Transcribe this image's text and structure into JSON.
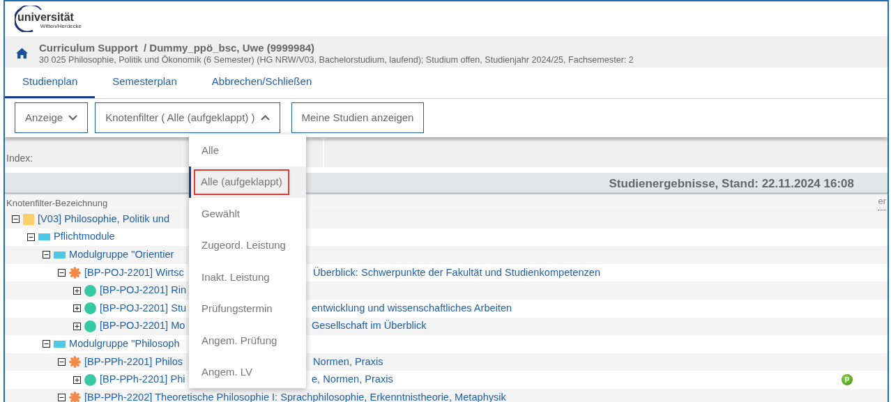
{
  "logo": {
    "wordmark_left": "uni",
    "wordmark_right": "versität",
    "subtitle": "Witten/Herdecke"
  },
  "header": {
    "title": "Curriculum Support  / Dummy_ppö_bsc, Uwe (9999984)",
    "subtitle": "30 025 Philosophie, Politik und Ökonomik (6 Semester) (HG NRW/V03, Bachelorstudium, laufend); Studium offen, Studienjahr 2024/25, Fachsemester: 2"
  },
  "tabs": [
    {
      "label": "Studienplan",
      "selected": true
    },
    {
      "label": "Semesterplan",
      "selected": false
    },
    {
      "label": "Abbrechen/Schließen",
      "selected": false
    }
  ],
  "toolbar": [
    {
      "label": "Anzeige",
      "kind": "dropdown",
      "expanded": false
    },
    {
      "label": "Knotenfilter ( Alle (aufgeklappt) )",
      "kind": "dropdown",
      "expanded": true
    },
    {
      "label": "Meine Studien anzeigen",
      "kind": "button"
    }
  ],
  "dropdown": [
    {
      "label": "Alle",
      "selected": false
    },
    {
      "label": "Alle (aufgeklappt)",
      "selected": true
    },
    {
      "label": "Gewählt",
      "selected": false
    },
    {
      "label": "Zugeord. Leistung",
      "selected": false
    },
    {
      "label": "Inakt. Leistung",
      "selected": false
    },
    {
      "label": "Prüfungstermin",
      "selected": false
    },
    {
      "label": "Angem. Prüfung",
      "selected": false
    },
    {
      "label": "Angem. LV",
      "selected": false
    }
  ],
  "index_label": "Index:",
  "results_title": "Studienergebnisse, Stand: 22.11.2024 16:08",
  "table": {
    "column_1": "Knotenfilter-Bezeichnung",
    "column_2": "er",
    "tree": [
      {
        "kind": "program",
        "text": "[V03] Philosophie, Politik und",
        "expanded": true,
        "children": [
          {
            "kind": "group",
            "text": "Pflichtmodule",
            "expanded": true,
            "children": [
              {
                "kind": "group",
                "text": "Modulgruppe \"Orientier",
                "expanded": true,
                "children": [
                  {
                    "kind": "module",
                    "text": "[BP-POJ-2201] Wirtsc",
                    "text_right": "Überblick: Schwerpunkte der Fakultät und Studienkompetenzen",
                    "expanded": true,
                    "children": [
                      {
                        "kind": "course",
                        "text": "[BP-POJ-2201] Rin",
                        "expanded": false
                      },
                      {
                        "kind": "course",
                        "text": "[BP-POJ-2201] Stu",
                        "text_right": "entwicklung und wissenschaftliches Arbeiten",
                        "expanded": false
                      },
                      {
                        "kind": "course",
                        "text": "[BP-POJ-2201] Mo",
                        "text_right": "Gesellschaft im Überblick",
                        "expanded": false
                      }
                    ]
                  }
                ]
              },
              {
                "kind": "group",
                "text": "Modulgruppe \"Philosoph",
                "expanded": true,
                "children": [
                  {
                    "kind": "module",
                    "text": "[BP-PPh-2201] Philos",
                    "text_right": "Normen, Praxis",
                    "expanded": true,
                    "children": [
                      {
                        "kind": "course",
                        "text": "[BP-PPh-2201] Phi",
                        "text_right": "e, Normen, Praxis",
                        "badge": "P",
                        "expanded": false
                      }
                    ]
                  },
                  {
                    "kind": "module",
                    "text": "[BP-PPh-2202] Theoretische Philosophie I: Sprachphilosophie, Erkenntnistheorie, Metaphysik",
                    "expanded": true
                  }
                ]
              }
            ]
          }
        ]
      }
    ]
  }
}
